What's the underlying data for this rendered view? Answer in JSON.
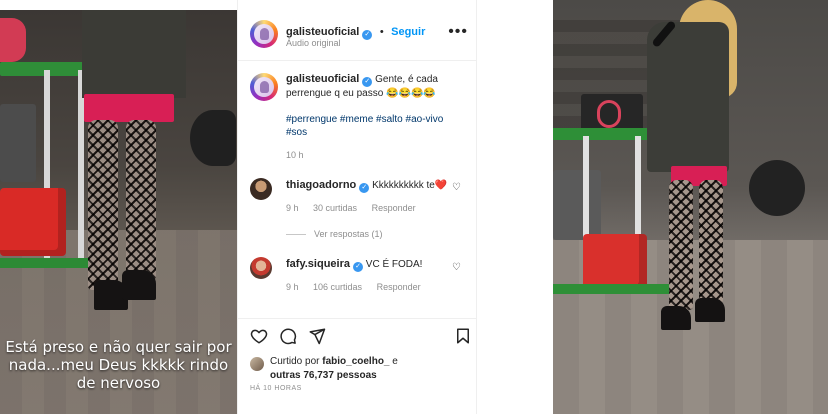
{
  "left_video": {
    "caption": "Está preso e não quer sair por nada...meu Deus kkkkk rindo de nervoso"
  },
  "post": {
    "username": "galisteuoficial",
    "follow_label": "Seguir",
    "audio_label": "Áudio original",
    "more_icon": "more-horizontal-icon"
  },
  "caption": {
    "username": "galisteuoficial",
    "text": "Gente, é cada perrengue q eu passo 😂😂😂😂",
    "hashtags": "#perrengue #meme #salto #ao-vivo #sos",
    "time": "10 h"
  },
  "comments": [
    {
      "username": "thiagoadorno",
      "text": "Kkkkkkkkkk te❤️",
      "time": "9 h",
      "likes": "30 curtidas",
      "reply_label": "Responder",
      "view_replies": "Ver respostas (1)"
    },
    {
      "username": "fafy.siqueira",
      "text": "VC É FODA!",
      "time": "9 h",
      "likes": "106 curtidas",
      "reply_label": "Responder"
    }
  ],
  "likes_summary": {
    "prefix": "Curtido por",
    "user": "fabio_coelho_",
    "middle": "e",
    "others": "outras 76,737 pessoas"
  },
  "time_ago": "HÁ 10 HORAS",
  "colors": {
    "link_blue": "#0095f6",
    "hashtag_blue": "#00376b",
    "muted": "#8e8e8e",
    "verified_blue": "#3897f0"
  }
}
